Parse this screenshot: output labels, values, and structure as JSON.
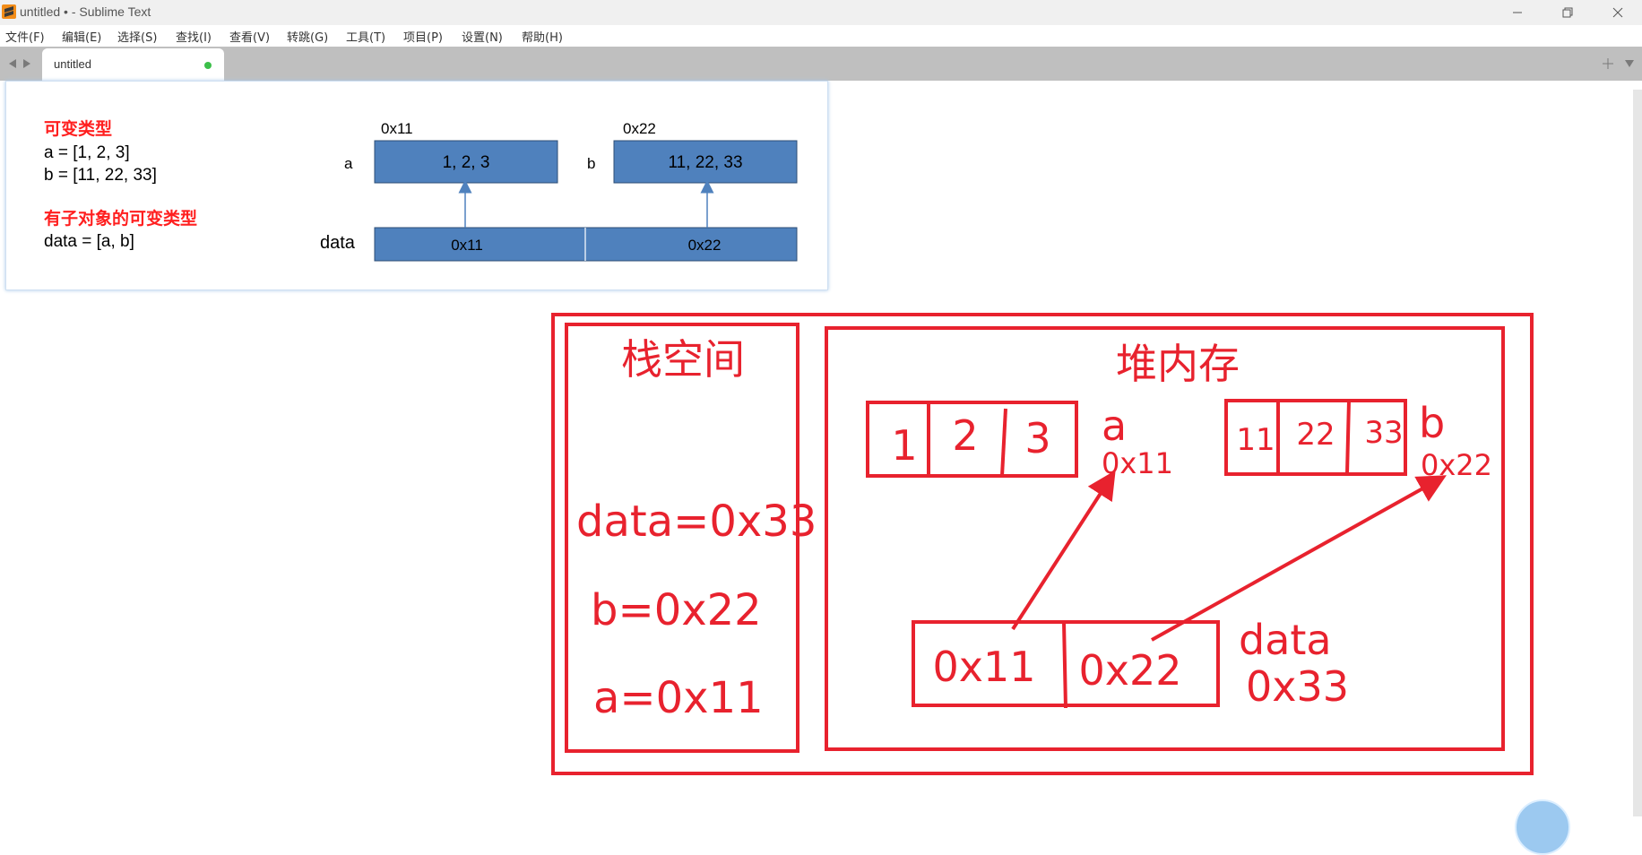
{
  "window": {
    "title": "untitled • - Sublime Text"
  },
  "menu": [
    "文件(F)",
    "编辑(E)",
    "选择(S)",
    "查找(I)",
    "查看(V)",
    "转跳(G)",
    "工具(T)",
    "项目(P)",
    "设置(N)",
    "帮助(H)"
  ],
  "tab": {
    "label": "untitled"
  },
  "slide": {
    "heading1": "可变类型",
    "line_a": "a = [1, 2, 3]",
    "line_b": "b = [11, 22, 33]",
    "heading2": "有子对象的可变类型",
    "line_data": "data = [a, b]",
    "addr_a": "0x11",
    "addr_b": "0x22",
    "label_a": "a",
    "label_b": "b",
    "label_data": "data",
    "box_a": "1, 2, 3",
    "box_b": "11, 22, 33",
    "cell1": "0x11",
    "cell2": "0x22"
  },
  "drawing": {
    "stack_title": "栈空间",
    "heap_title": "堆内存",
    "stack_data": "data=0x33",
    "stack_b": "b=0x22",
    "stack_a": "a=0x11",
    "list_a_cells": [
      "1",
      "2",
      "3"
    ],
    "list_a_name": "a",
    "list_a_addr": "0x11",
    "list_b_cells": [
      "11",
      "22",
      "33"
    ],
    "list_b_name": "b",
    "list_b_addr": "0x22",
    "data_cells": [
      "0x11",
      "0x22"
    ],
    "data_name": "data",
    "data_addr": "0x33"
  },
  "colors": {
    "ink": "#e8222e",
    "slide_blue": "#4f81bd",
    "slide_red": "#ff1f1f",
    "tabbar": "#bfbfbf"
  }
}
